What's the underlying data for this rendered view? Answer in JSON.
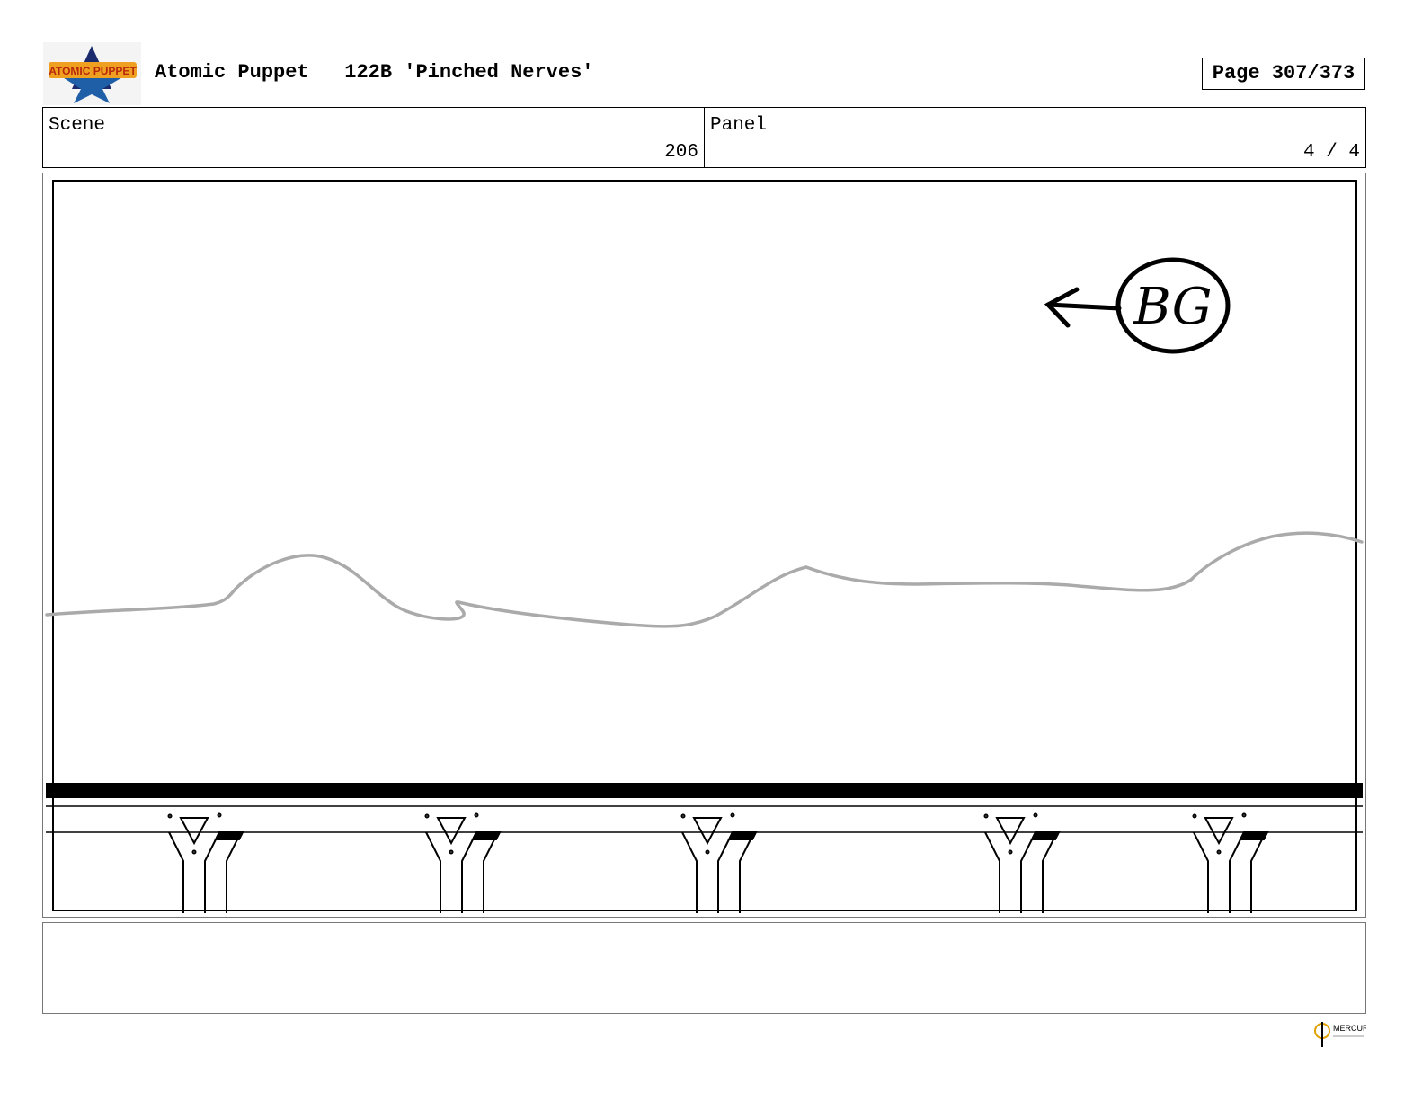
{
  "header": {
    "show_title": "Atomic Puppet",
    "episode_title": "122B 'Pinched Nerves'",
    "page_label": "Page 307/373",
    "logo_text": "ATOMIC PUPPET"
  },
  "info": {
    "scene_label": "Scene",
    "scene_value": "206",
    "panel_label": "Panel",
    "panel_value": "4 / 4"
  },
  "panel": {
    "bg_annotation": "BG",
    "arrow_direction": "left"
  },
  "notes": {
    "text": ""
  },
  "footer": {
    "studio_logo_text": "MERCURY"
  }
}
